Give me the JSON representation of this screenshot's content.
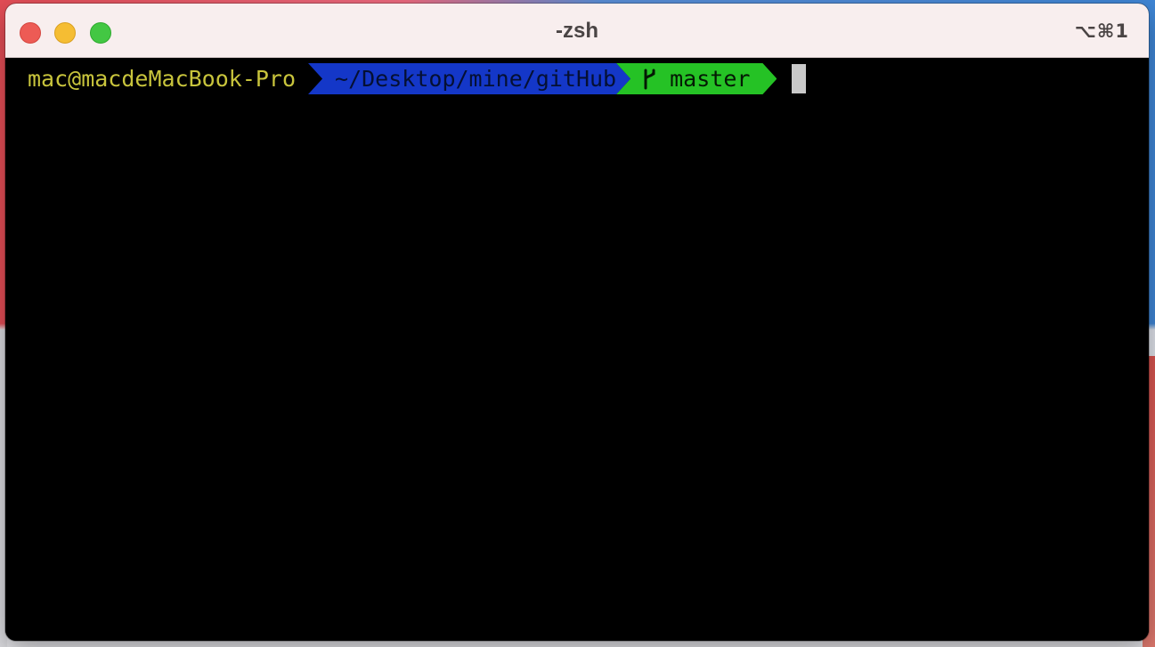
{
  "window": {
    "title": "-zsh",
    "shortcut": "⌥⌘1"
  },
  "prompt": {
    "user_host": "mac@macdeMacBook-Pro",
    "path": "~/Desktop/mine/gitHub",
    "branch_icon": "git-branch-icon",
    "branch_glyph": "ᚴ",
    "branch": "master"
  },
  "colors": {
    "user_host": "#c8c43c",
    "path_segment": "#1437c8",
    "git_segment": "#25c225",
    "cursor": "#c9c9c9",
    "terminal_bg": "#000000",
    "titlebar_bg": "#f8eeee"
  }
}
